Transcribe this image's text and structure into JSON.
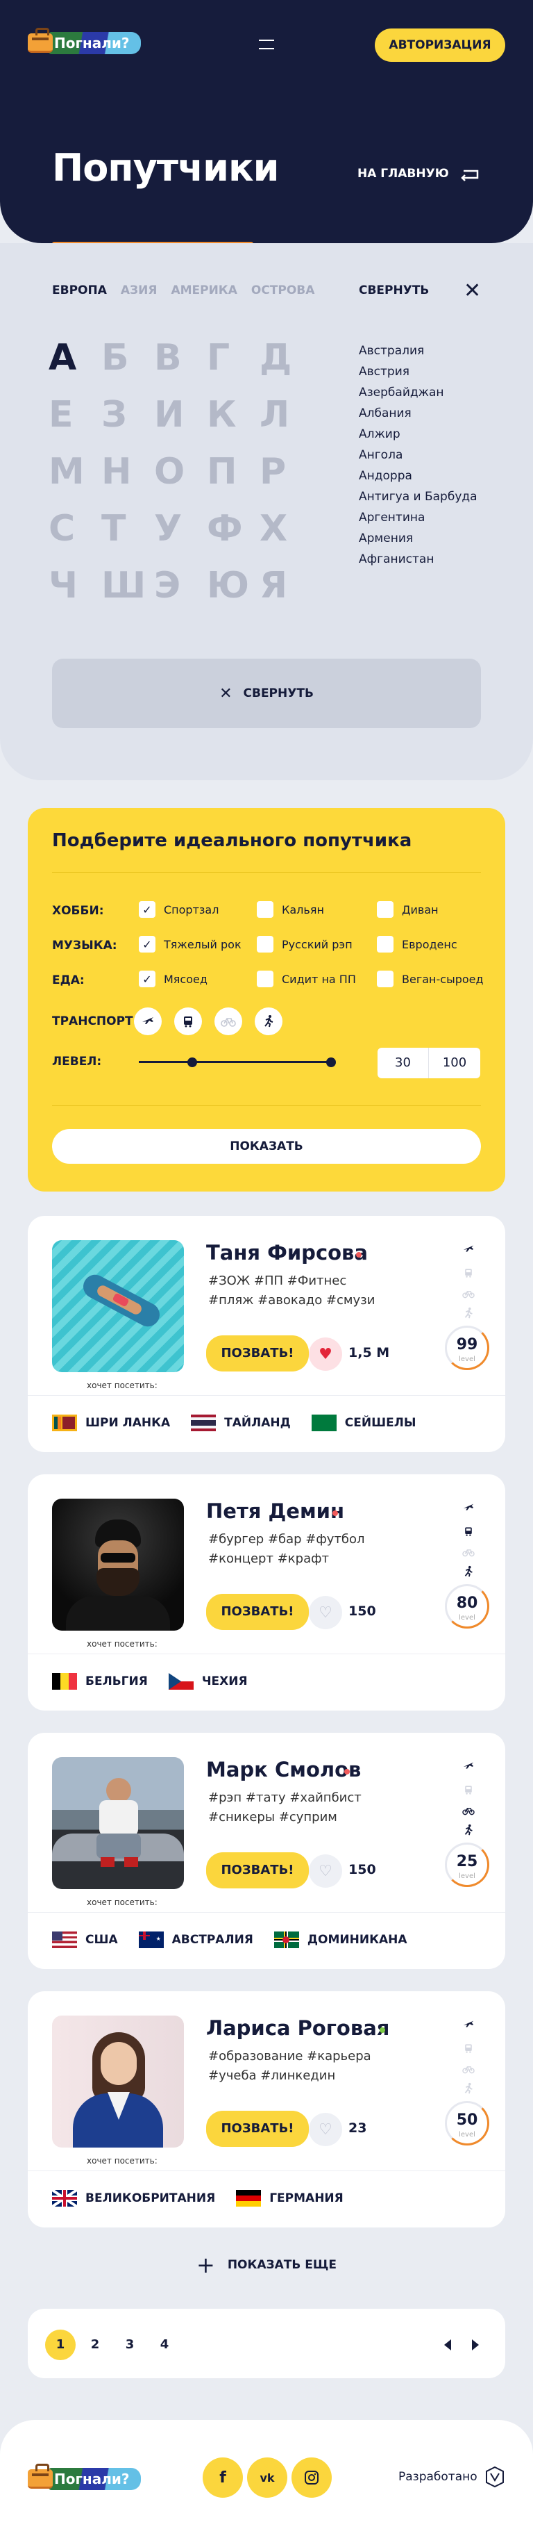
{
  "header": {
    "logo_text": "Погнали?",
    "auth_button": "АВТОРИЗАЦИЯ",
    "title": "Попутчики",
    "to_home": "НА ГЛАВНУЮ"
  },
  "countries": {
    "regions": [
      "ЕВРОПА",
      "АЗИЯ",
      "АМЕРИКА",
      "ОСТРОВА"
    ],
    "collapse_label": "СВЕРНУТЬ",
    "letters": [
      "А",
      "Б",
      "В",
      "Г",
      "Д",
      "Е",
      "З",
      "И",
      "К",
      "Л",
      "М",
      "Н",
      "О",
      "П",
      "Р",
      "С",
      "Т",
      "У",
      "Ф",
      "Х",
      "Ч",
      "Ш",
      "Э",
      "Ю",
      "Я"
    ],
    "list": [
      "Австралия",
      "Австрия",
      "Азербайджан",
      "Албания",
      "Алжир",
      "Ангола",
      "Андорра",
      "Антигуа и Барбуда",
      "Аргентина",
      "Армения",
      "Афганистан"
    ],
    "collapse_button": "СВЕРНУТЬ"
  },
  "filter": {
    "title": "Подберите идеального попутчика",
    "hobby_label": "ХОББИ:",
    "hobby": [
      "Спортзал",
      "Кальян",
      "Диван"
    ],
    "music_label": "МУЗЫКА:",
    "music": [
      "Тяжелый рок",
      "Русский рэп",
      "Евроденс"
    ],
    "food_label": "ЕДА:",
    "food": [
      "Мясоед",
      "Сидит на ПП",
      "Веган-сыроед"
    ],
    "transport_label": "ТРАНСПОРТ:",
    "level_label": "ЛЕВЕЛ:",
    "level_min": "30",
    "level_max": "100",
    "show_button": "ПОКАЗАТЬ"
  },
  "card_common": {
    "invite": "ПОЗВАТЬ!",
    "wants": "хочет посетить:",
    "level_word": "level"
  },
  "travelers": [
    {
      "name": "Таня Фирсова",
      "tags": "#ЗОЖ #ПП #Фитнес #пляж #авокадо #смузи",
      "likes": "1,5 M",
      "level": "99",
      "liked": true,
      "online_color": "#f25a5a",
      "countries": [
        "ШРИ ЛАНКА",
        "ТАЙЛАНД",
        "СЕЙШЕЛЫ"
      ]
    },
    {
      "name": "Петя Демин",
      "tags": "#бургер #бар #футбол #концерт #крафт",
      "likes": "150",
      "level": "80",
      "liked": false,
      "online_color": "#f25a5a",
      "countries": [
        "БЕЛЬГИЯ",
        "ЧЕХИЯ"
      ]
    },
    {
      "name": "Марк Смолов",
      "tags": "#рэп #тату #хайпбист #сникеры #суприм",
      "likes": "150",
      "level": "25",
      "liked": false,
      "online_color": "#f25a5a",
      "countries": [
        "США",
        "АВСТРАЛИЯ",
        "ДОМИНИКАНА"
      ]
    },
    {
      "name": "Лариса Роговая",
      "tags": "#образование #карьера #учеба #линкедин",
      "likes": "23",
      "level": "50",
      "liked": false,
      "online_color": "#7ac943",
      "countries": [
        "ВЕЛИКОБРИТАНИЯ",
        "ГЕРМАНИЯ"
      ]
    }
  ],
  "show_more": "ПОКАЗАТЬ ЕЩЕ",
  "pagination": [
    "1",
    "2",
    "3",
    "4"
  ],
  "footer": {
    "logo_text": "Погнали?",
    "developed": "Разработано"
  },
  "colors": {
    "navy": "#161c3c",
    "yellow": "#fbd63d",
    "orange": "#f08a2b",
    "bg": "#e9ecf2"
  }
}
